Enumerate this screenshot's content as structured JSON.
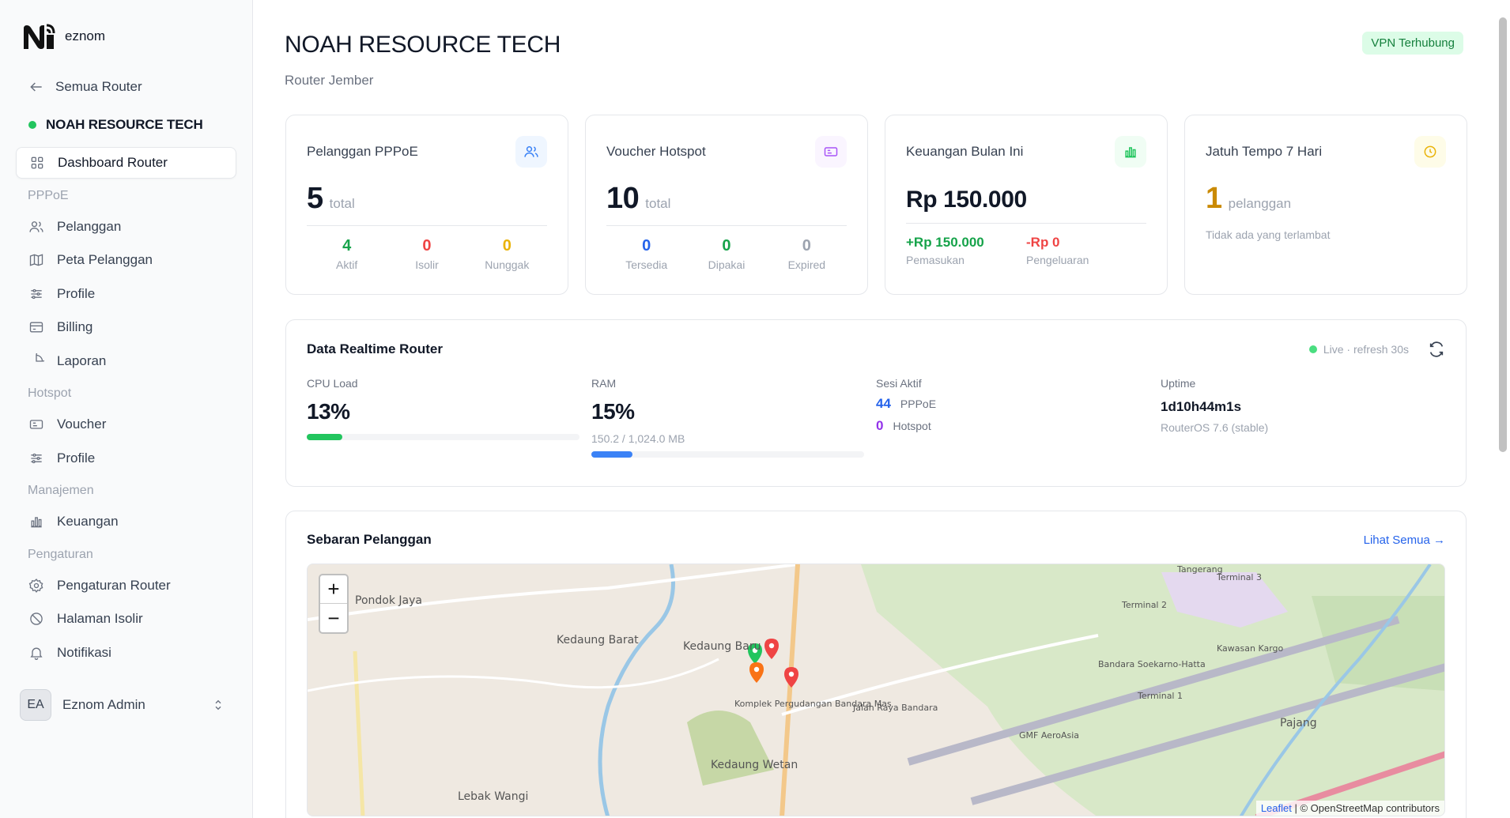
{
  "brand": {
    "name": "eznom"
  },
  "sidebar": {
    "back_label": "Semua Router",
    "router_name": "NOAH RESOURCE TECH",
    "dashboard_label": "Dashboard Router",
    "groups": {
      "pppoe": "PPPoE",
      "hotspot": "Hotspot",
      "manajemen": "Manajemen",
      "pengaturan": "Pengaturan"
    },
    "items": {
      "pelanggan": "Pelanggan",
      "peta": "Peta Pelanggan",
      "profile_pppoe": "Profile",
      "billing": "Billing",
      "laporan": "Laporan",
      "voucher": "Voucher",
      "profile_hotspot": "Profile",
      "keuangan": "Keuangan",
      "pengaturan_router": "Pengaturan Router",
      "halaman_isolir": "Halaman Isolir",
      "notifikasi": "Notifikasi"
    },
    "user": {
      "initials": "EA",
      "name": "Eznom Admin"
    }
  },
  "header": {
    "title": "NOAH RESOURCE TECH",
    "subtitle": "Router Jember",
    "vpn_status": "VPN Terhubung"
  },
  "stats": {
    "pppoe": {
      "title": "Pelanggan PPPoE",
      "total": "5",
      "unit": "total",
      "aktif": {
        "value": "4",
        "label": "Aktif"
      },
      "isolir": {
        "value": "0",
        "label": "Isolir"
      },
      "nunggak": {
        "value": "0",
        "label": "Nunggak"
      }
    },
    "voucher": {
      "title": "Voucher Hotspot",
      "total": "10",
      "unit": "total",
      "tersedia": {
        "value": "0",
        "label": "Tersedia"
      },
      "dipakai": {
        "value": "0",
        "label": "Dipakai"
      },
      "expired": {
        "value": "0",
        "label": "Expired"
      }
    },
    "keuangan": {
      "title": "Keuangan Bulan Ini",
      "amount": "Rp 150.000",
      "pemasukan": {
        "value": "+Rp 150.000",
        "label": "Pemasukan"
      },
      "pengeluaran": {
        "value": "-Rp 0",
        "label": "Pengeluaran"
      }
    },
    "jatuh_tempo": {
      "title": "Jatuh Tempo 7 Hari",
      "count": "1",
      "unit": "pelanggan",
      "note": "Tidak ada yang terlambat"
    }
  },
  "realtime": {
    "title": "Data Realtime Router",
    "live_text": "Live · refresh 30s",
    "cpu": {
      "label": "CPU Load",
      "value": "13%",
      "fraction": 0.13
    },
    "ram": {
      "label": "RAM",
      "value": "15%",
      "detail": "150.2 / 1,024.0 MB",
      "fraction": 0.15
    },
    "sessions": {
      "label": "Sesi Aktif",
      "pppoe_count": "44",
      "pppoe_label": "PPPoE",
      "hotspot_count": "0",
      "hotspot_label": "Hotspot"
    },
    "uptime": {
      "label": "Uptime",
      "value": "1d10h44m1s",
      "os": "RouterOS 7.6 (stable)"
    }
  },
  "map": {
    "title": "Sebaran Pelanggan",
    "link": "Lihat Semua →",
    "zoom_in": "+",
    "zoom_out": "−",
    "attribution_leaflet": "Leaflet",
    "attribution_rest": "| © OpenStreetMap contributors",
    "place_labels": [
      "Pondok Jaya",
      "Kedaung Barat",
      "Kedaung Baru",
      "Kedaung Wetan",
      "Lebak Wangi",
      "Komplek Pergudangan Bandara Mas",
      "Bandara Soekarno-Hatta",
      "Terminal 1",
      "Terminal 2",
      "Terminal 3",
      "Kawasan Kargo",
      "Pajang",
      "GMF AeroAsia",
      "Jalan Raya Bandara",
      "Tangerang"
    ]
  },
  "colors": {
    "green": "#16a34a",
    "red": "#ef4444",
    "amber": "#eab308",
    "blue": "#2563eb",
    "purple": "#9333ea",
    "cpu_bar": "#22c55e",
    "ram_bar": "#3b82f6"
  }
}
